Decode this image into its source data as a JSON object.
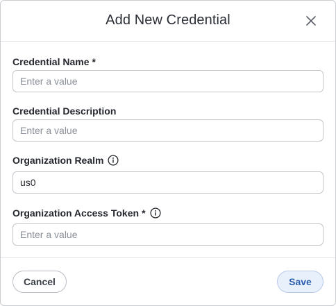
{
  "dialog": {
    "title": "Add New Credential",
    "close_icon": "close-icon"
  },
  "fields": {
    "name": {
      "label": "Credential Name",
      "required_mark": "*",
      "value": "",
      "placeholder": "Enter a value"
    },
    "description": {
      "label": "Credential Description",
      "value": "",
      "placeholder": "Enter a value"
    },
    "realm": {
      "label": "Organization Realm",
      "info_icon": "info-icon",
      "value": "us0",
      "placeholder": "Enter a value"
    },
    "token": {
      "label": "Organization Access Token",
      "required_mark": "*",
      "info_icon": "info-icon",
      "value": "",
      "placeholder": "Enter a value"
    }
  },
  "footer": {
    "cancel_label": "Cancel",
    "save_label": "Save"
  },
  "colors": {
    "save_bg": "#e8f0fb",
    "save_text": "#2d5fb0",
    "border": "#c3c7cc"
  }
}
